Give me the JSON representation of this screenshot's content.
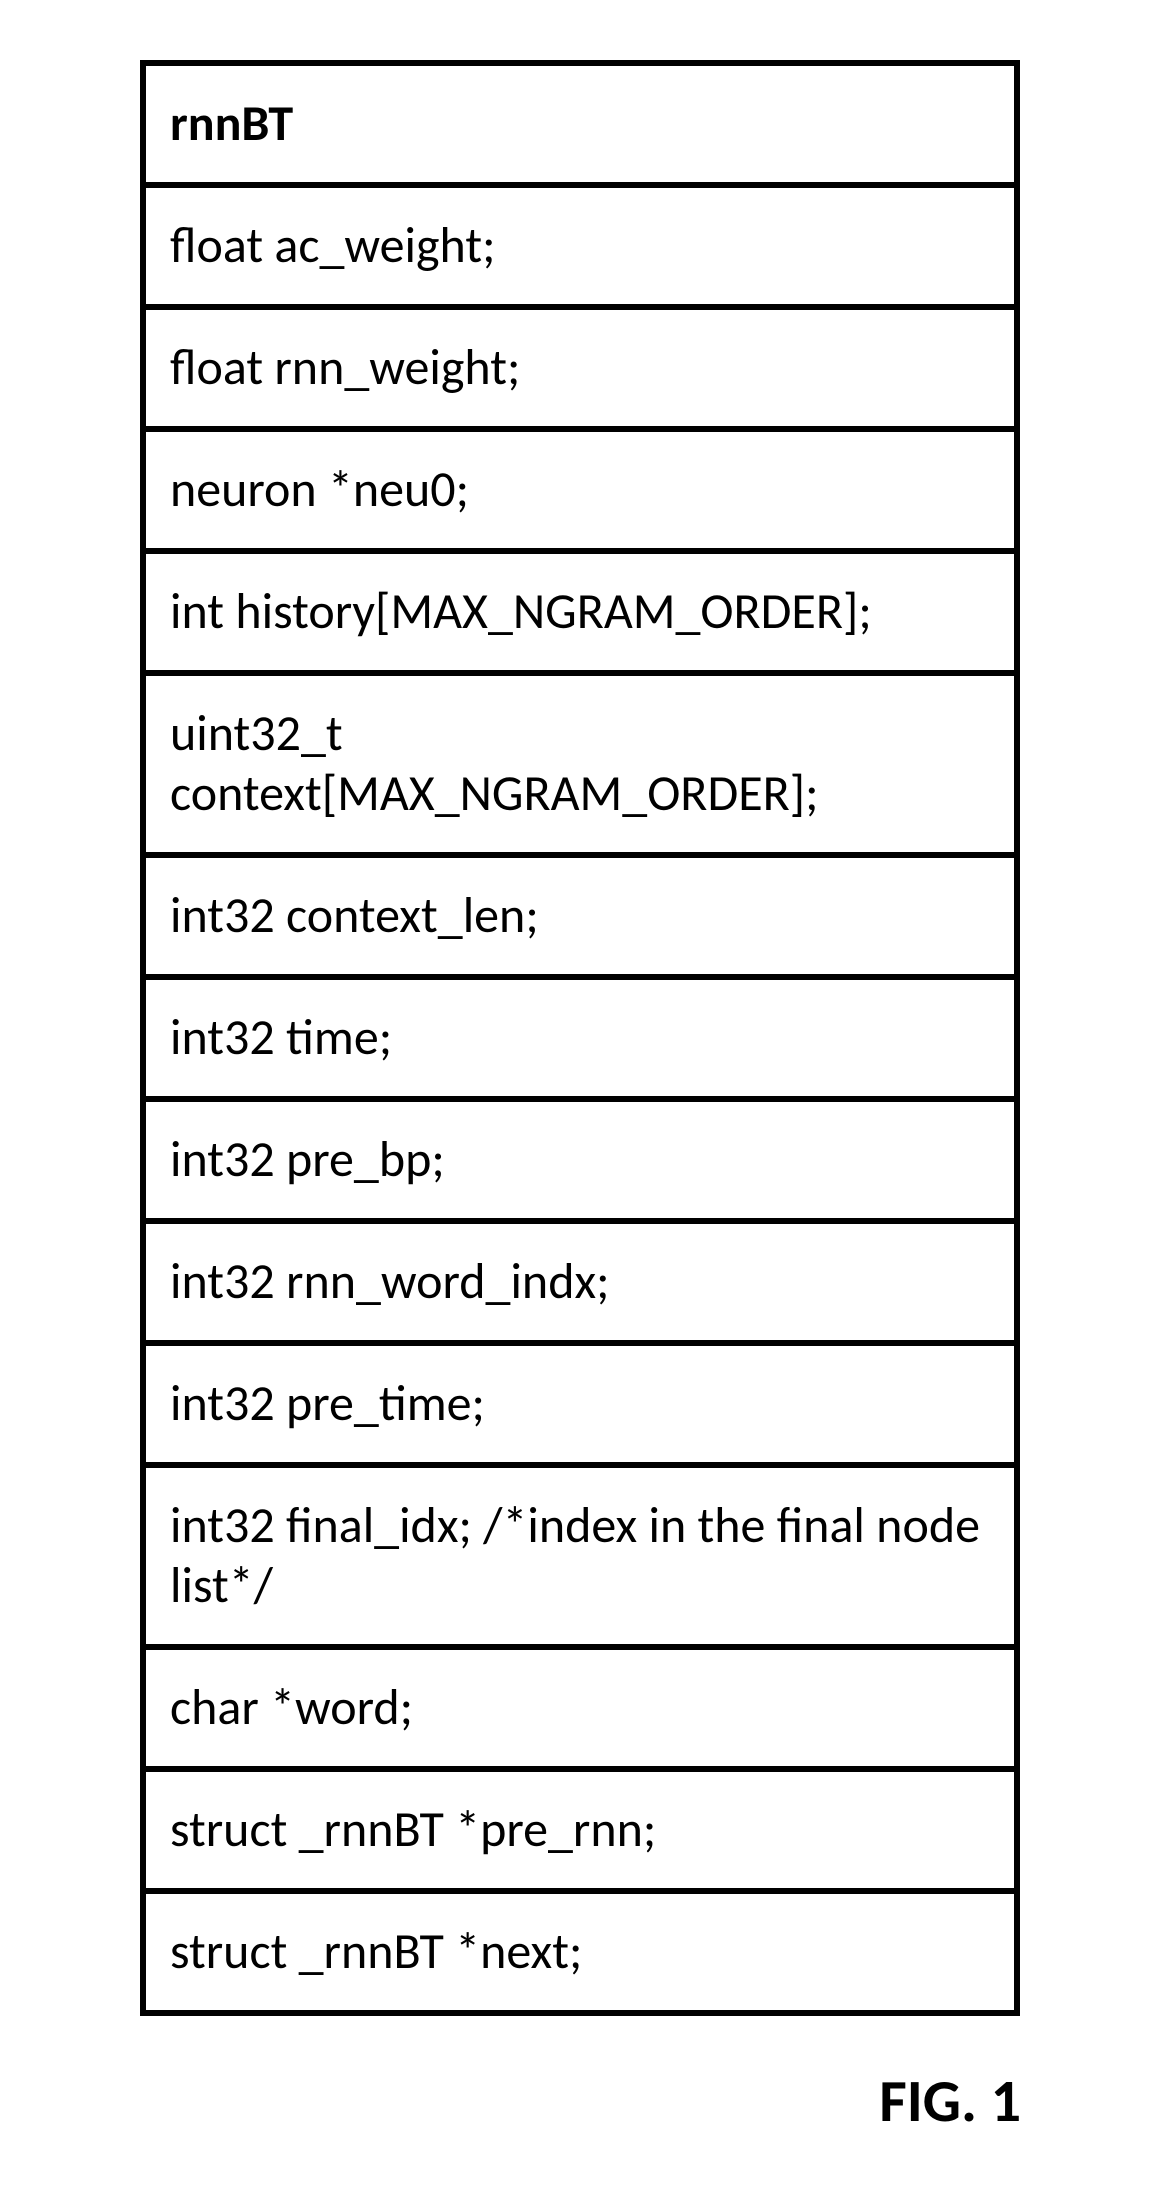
{
  "struct": {
    "name": "rnnBT",
    "members": [
      "float ac_weight;",
      "float rnn_weight;",
      "neuron *neu0;",
      "int history[MAX_NGRAM_ORDER];",
      "uint32_t context[MAX_NGRAM_ORDER];",
      "int32 context_len;",
      "int32 time;",
      "int32 pre_bp;",
      "int32 rnn_word_indx;",
      "int32 pre_time;",
      "int32 final_idx; /*index in the final node list*/",
      "char *word;",
      "struct _rnnBT *pre_rnn;",
      "struct _rnnBT *next;"
    ]
  },
  "figure_label": "FIG. 1"
}
